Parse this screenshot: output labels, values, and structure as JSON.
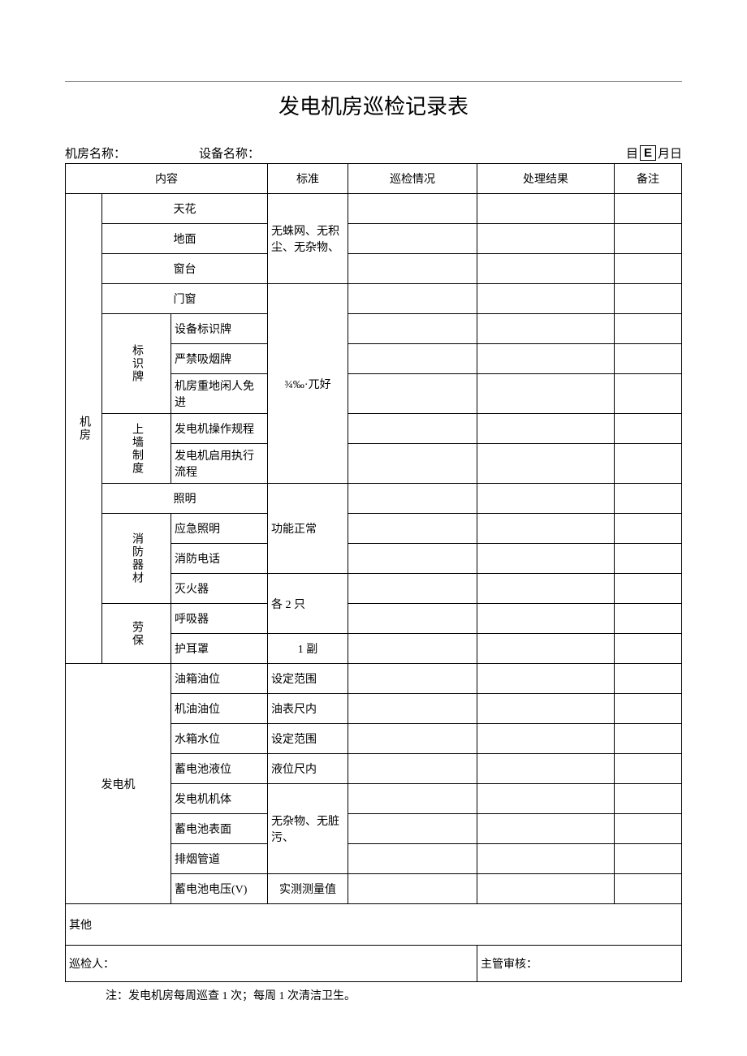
{
  "title": "发电机房巡检记录表",
  "meta": {
    "room_label": "机房名称：",
    "device_label": "设备名称：",
    "date_mu": "目",
    "date_e": "E",
    "date_month_day": "月日"
  },
  "header": {
    "content": "内容",
    "standard": "标准",
    "inspect": "巡检情况",
    "result": "处理结果",
    "remark": "备注"
  },
  "groups": {
    "room": "机房",
    "sign": "标识牌",
    "wall": "上墙制度",
    "fire": "消防器材",
    "labor": "劳保",
    "gen": "发电机"
  },
  "rows": {
    "ceiling": "天花",
    "floor": "地面",
    "sill": "窗台",
    "door": "门窗",
    "dev_sign": "设备标识牌",
    "no_smoke": "严禁吸烟牌",
    "no_entry": "机房重地闲人免进",
    "op_rule": "发电机操作规程",
    "start_flow": "发电机启用执行流程",
    "lighting": "照明",
    "emer_light": "应急照明",
    "fire_phone": "消防电话",
    "extinguisher": "灭火器",
    "respirator": "呼吸器",
    "earmuff": "护耳罩",
    "tank_level": "油箱油位",
    "oil_level": "机油油位",
    "water_level": "水箱水位",
    "batt_level": "蓄电池液位",
    "gen_body": "发电机机体",
    "batt_surface": "蓄电池表面",
    "exhaust": "排烟管道",
    "batt_volt": "蓄电池电压(V)"
  },
  "std": {
    "clean": "无蛛网、无积尘、无杂物、",
    "intact": "¾‰·兀好",
    "func_ok": "功能正常",
    "two_each": "各 2 只",
    "one_pair": "1 副",
    "set_range": "设定范围",
    "dipstick": "油表尺内",
    "level_in": "液位尺内",
    "no_dirt": "无杂物、无脏污、",
    "measured": "实测测量值"
  },
  "footer": {
    "other": "其他",
    "inspector": "巡检人：",
    "supervisor": "主管审核："
  },
  "note": "注：发电机房每周巡查 1 次；每周 1 次清洁卫生。"
}
